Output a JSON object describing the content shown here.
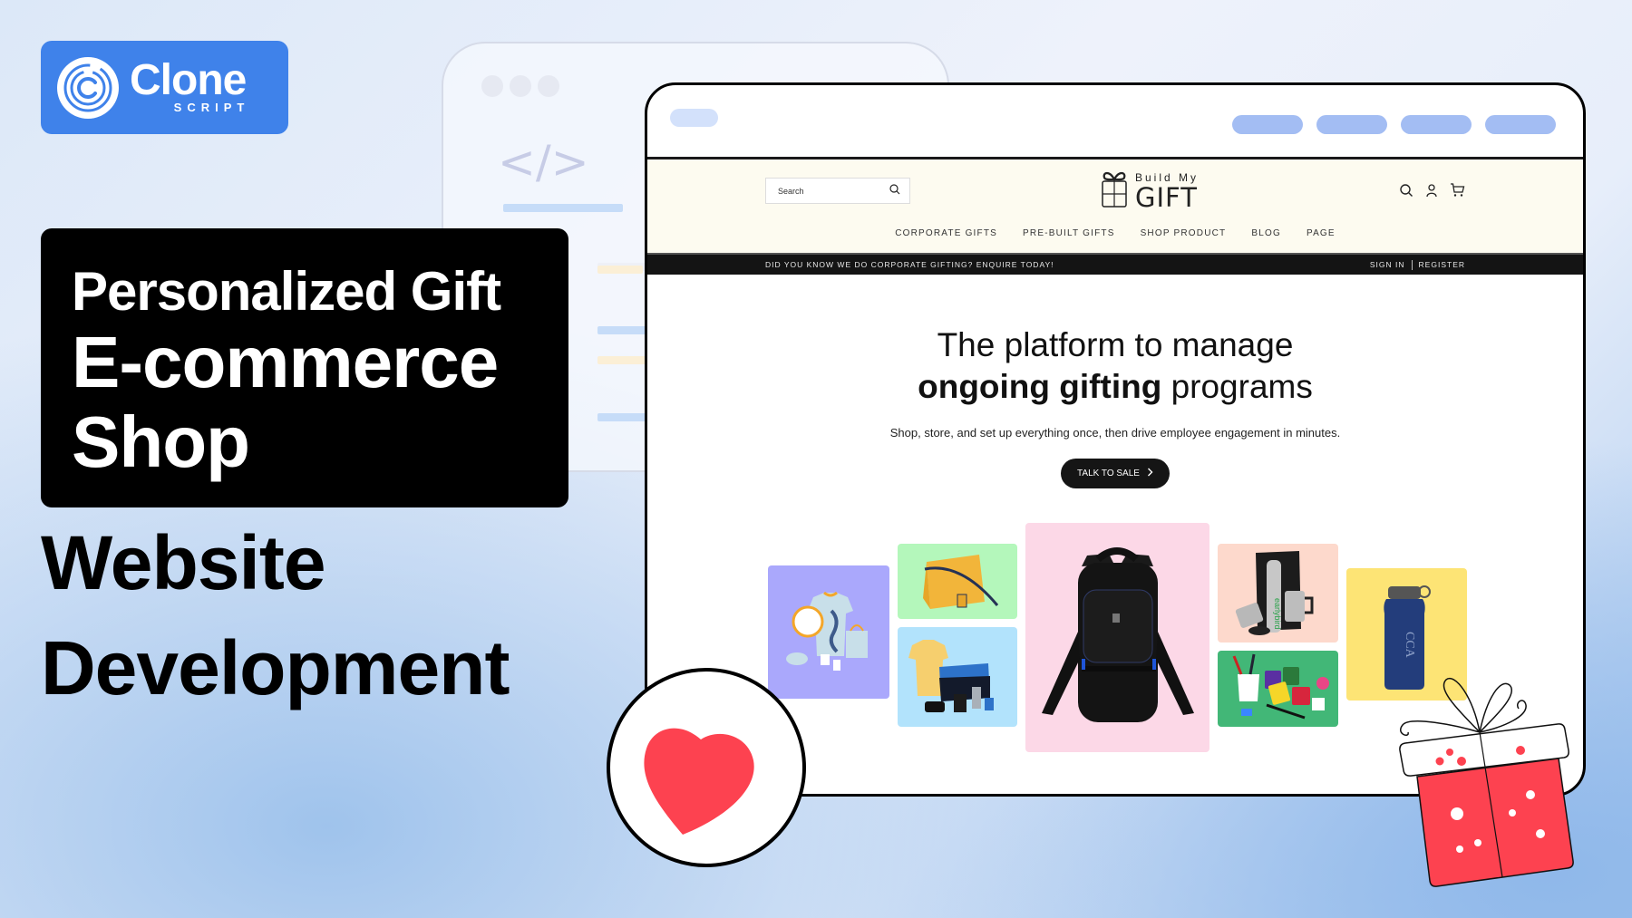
{
  "brand": {
    "name": "Clone",
    "tagline": "SCRIPT",
    "color": "#3f82ea"
  },
  "headline": {
    "line1": "Personalized Gift",
    "line2": "E-commerce",
    "line3": "Shop",
    "sub_line1": "Website",
    "sub_line2": "Development"
  },
  "code_window": {
    "icon": "code-tag-icon",
    "tag_text": "</>"
  },
  "site": {
    "search": {
      "placeholder": "Search",
      "value": ""
    },
    "logo": {
      "small": "Build My",
      "big": "GIFT"
    },
    "header_icons": [
      "search-icon",
      "user-icon",
      "cart-icon"
    ],
    "nav": [
      {
        "label": "CORPORATE GIFTS"
      },
      {
        "label": "PRE-BUILT GIFTS"
      },
      {
        "label": "SHOP PRODUCT"
      },
      {
        "label": "BLOG"
      },
      {
        "label": "PAGE"
      }
    ],
    "promo": {
      "message": "DID YOU KNOW WE DO CORPORATE GIFTING? ENQUIRE TODAY!",
      "sign_in": "SIGN IN",
      "register": "REGISTER"
    },
    "hero": {
      "title_line1": "The platform to manage",
      "title_bold": "ongoing gifting",
      "title_rest": " programs",
      "description": "Shop, store, and set up everything once, then drive employee engagement in minutes.",
      "cta_label": "TALK TO SALE"
    },
    "products": [
      {
        "name": "branded-merch-set",
        "bg": "#aaa8fc"
      },
      {
        "name": "yellow-messenger-bag",
        "bg": "#b4f7bb"
      },
      {
        "name": "corporate-polo-kit",
        "bg": "#b2e3fc"
      },
      {
        "name": "black-backpack",
        "bg": "#fcd8e7"
      },
      {
        "name": "thermos-mug-set",
        "bg": "#fdd9cc"
      },
      {
        "name": "mugs-pens-set",
        "bg": "#42b777"
      },
      {
        "name": "blue-water-bottle",
        "bg": "#fde475"
      }
    ]
  },
  "colors": {
    "accent_red": "#fd4250",
    "header_bg": "#fdfbf0",
    "pill_blue": "#a3bdf3"
  }
}
